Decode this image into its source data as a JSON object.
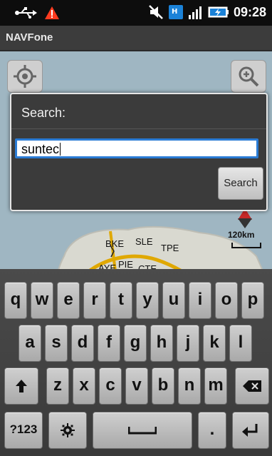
{
  "status_bar": {
    "time": "09:28",
    "icons": [
      "usb-icon",
      "warning-icon",
      "mute-icon",
      "hspa-icon",
      "signal-icon",
      "battery-charging-icon"
    ],
    "warning_color": "#ff3b1f"
  },
  "app_bar": {
    "title": "NAVFone"
  },
  "map": {
    "scale_label": "120km",
    "road_labels": [
      "BKE",
      "SLE",
      "TPE",
      "AYE",
      "PIE",
      "CTE"
    ],
    "colors": {
      "sea": "#9fb6c2",
      "land": "#d9d9d0",
      "highway": "#e0a800"
    }
  },
  "dialog": {
    "title": "Search:",
    "input_value": "suntec",
    "button_label": "Search"
  },
  "keyboard": {
    "row1": [
      "q",
      "w",
      "e",
      "r",
      "t",
      "y",
      "u",
      "i",
      "o",
      "p"
    ],
    "row2": [
      "a",
      "s",
      "d",
      "f",
      "g",
      "h",
      "j",
      "k",
      "l"
    ],
    "row3": [
      "z",
      "x",
      "c",
      "v",
      "b",
      "n",
      "m"
    ],
    "symbols_label": "?123",
    "period_label": "."
  }
}
